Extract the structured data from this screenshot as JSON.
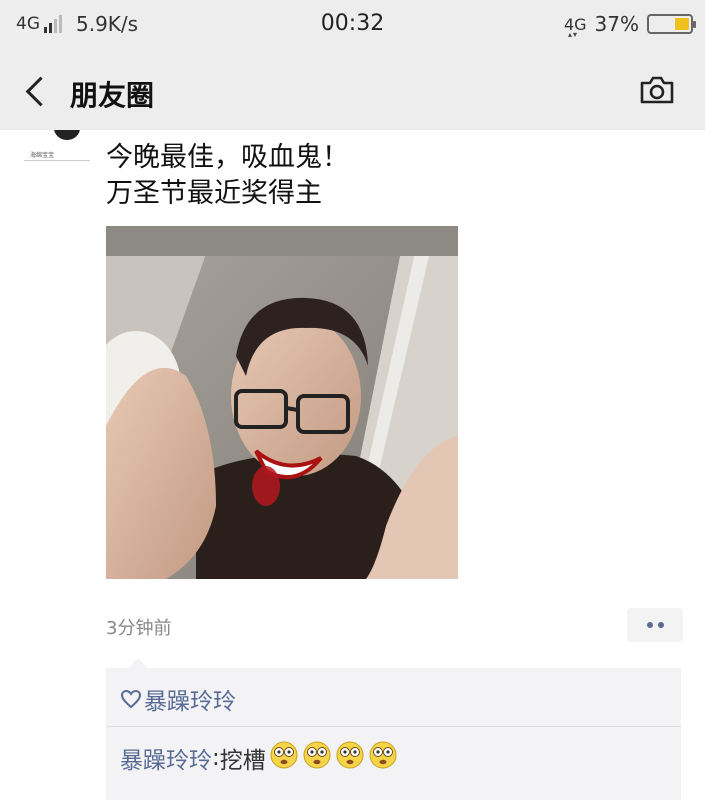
{
  "status_bar": {
    "network": "4G",
    "speed": "5.9K/s",
    "time": "00:32",
    "network_right": "4G",
    "battery": "37%",
    "battery_level": 0.37
  },
  "nav": {
    "title": "朋友圈",
    "back_icon": "chevron-left-icon",
    "camera_icon": "camera-icon"
  },
  "post": {
    "avatar_caption": "海绵宝宝",
    "text_line1": "今晚最佳，吸血鬼！",
    "text_line2": "万圣节最近奖得主",
    "time": "3分钟前"
  },
  "interactions": {
    "like_icon": "heart-outline-icon",
    "likes": "暴躁玲玲",
    "comment": {
      "author": "暴躁玲玲",
      "separator": ": ",
      "text": "挖槽",
      "emoji_icon": "dizzy-face-icon",
      "emoji_count": 4
    }
  },
  "colors": {
    "bar_bg": "#ededed",
    "link_blue": "#576b95",
    "battery_yellow": "#f0c21c"
  }
}
